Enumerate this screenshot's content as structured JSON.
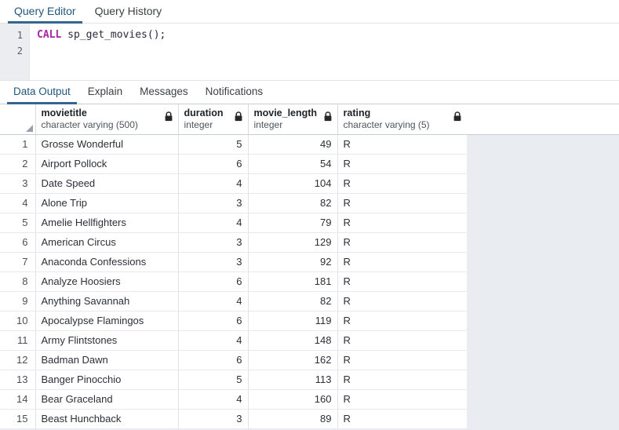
{
  "top_tabs": [
    {
      "label": "Query Editor",
      "active": true
    },
    {
      "label": "Query History",
      "active": false
    }
  ],
  "editor": {
    "line_numbers": [
      "1",
      "2"
    ],
    "lines": [
      {
        "keyword": "CALL",
        "rest": " sp_get_movies();"
      },
      {
        "keyword": "",
        "rest": ""
      }
    ],
    "full_text": "CALL sp_get_movies();"
  },
  "result_tabs": [
    {
      "label": "Data Output",
      "active": true
    },
    {
      "label": "Explain",
      "active": false
    },
    {
      "label": "Messages",
      "active": false
    },
    {
      "label": "Notifications",
      "active": false
    }
  ],
  "grid": {
    "columns": [
      {
        "name": "movietitle",
        "type": "character varying (500)",
        "align": "txt",
        "locked": true
      },
      {
        "name": "duration",
        "type": "integer",
        "align": "num",
        "locked": true
      },
      {
        "name": "movie_length",
        "type": "integer",
        "align": "num",
        "locked": true
      },
      {
        "name": "rating",
        "type": "character varying (5)",
        "align": "txt",
        "locked": true
      }
    ],
    "rows": [
      {
        "n": "1",
        "cells": [
          "Grosse Wonderful",
          "5",
          "49",
          "R"
        ]
      },
      {
        "n": "2",
        "cells": [
          "Airport Pollock",
          "6",
          "54",
          "R"
        ]
      },
      {
        "n": "3",
        "cells": [
          "Date Speed",
          "4",
          "104",
          "R"
        ]
      },
      {
        "n": "4",
        "cells": [
          "Alone Trip",
          "3",
          "82",
          "R"
        ]
      },
      {
        "n": "5",
        "cells": [
          "Amelie Hellfighters",
          "4",
          "79",
          "R"
        ]
      },
      {
        "n": "6",
        "cells": [
          "American Circus",
          "3",
          "129",
          "R"
        ]
      },
      {
        "n": "7",
        "cells": [
          "Anaconda Confessions",
          "3",
          "92",
          "R"
        ]
      },
      {
        "n": "8",
        "cells": [
          "Analyze Hoosiers",
          "6",
          "181",
          "R"
        ]
      },
      {
        "n": "9",
        "cells": [
          "Anything Savannah",
          "4",
          "82",
          "R"
        ]
      },
      {
        "n": "10",
        "cells": [
          "Apocalypse Flamingos",
          "6",
          "119",
          "R"
        ]
      },
      {
        "n": "11",
        "cells": [
          "Army Flintstones",
          "4",
          "148",
          "R"
        ]
      },
      {
        "n": "12",
        "cells": [
          "Badman Dawn",
          "6",
          "162",
          "R"
        ]
      },
      {
        "n": "13",
        "cells": [
          "Banger Pinocchio",
          "5",
          "113",
          "R"
        ]
      },
      {
        "n": "14",
        "cells": [
          "Bear Graceland",
          "4",
          "160",
          "R"
        ]
      },
      {
        "n": "15",
        "cells": [
          "Beast Hunchback",
          "3",
          "89",
          "R"
        ]
      }
    ]
  },
  "icons": {
    "lock": "lock-icon",
    "sort_corner": "sort-corner-triangle-icon"
  },
  "colors": {
    "accent": "#326690",
    "active_tab_text": "#22577d",
    "keyword": "#a626a4",
    "gutter_bg": "#ecedf1",
    "filler_bg": "#e9ecf1"
  }
}
